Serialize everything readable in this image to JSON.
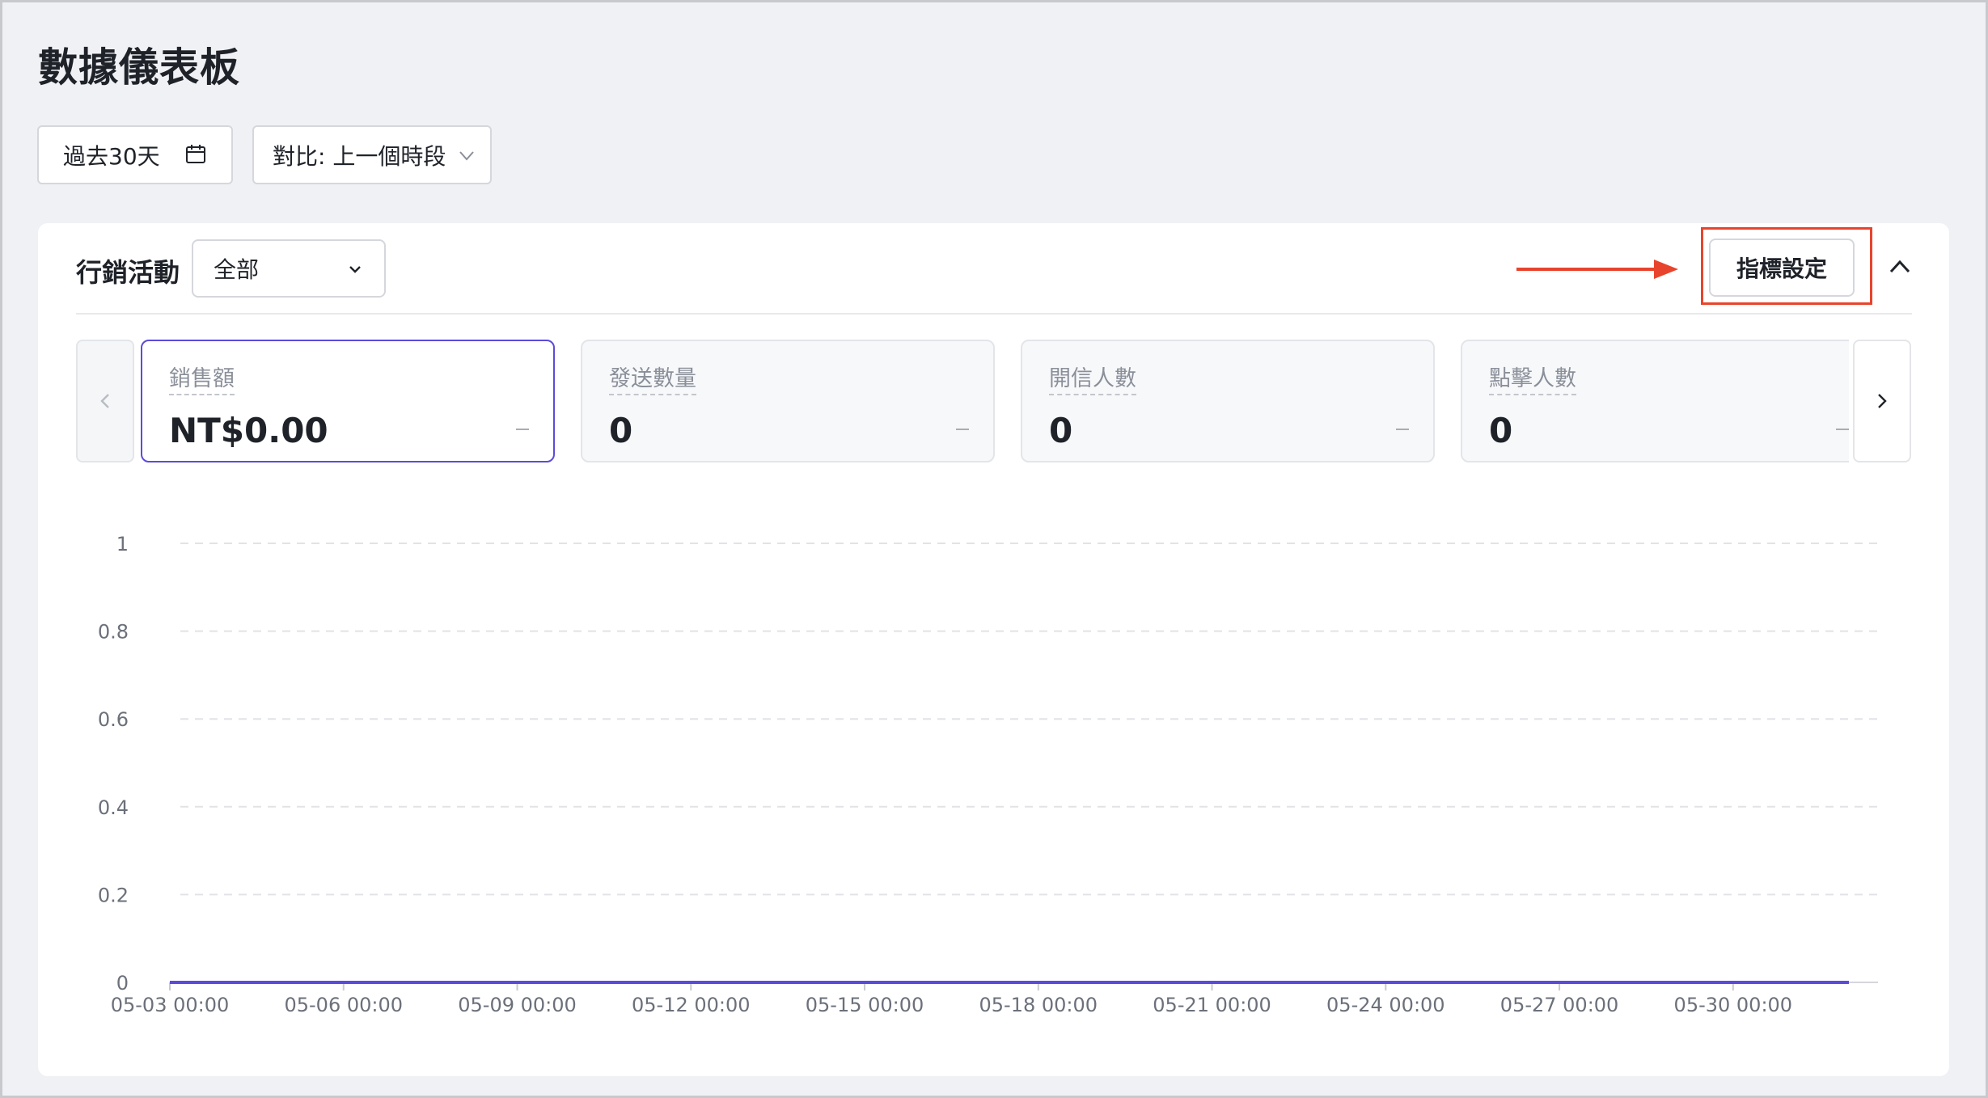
{
  "page": {
    "title": "數據儀表板"
  },
  "filters": {
    "date_range_label": "過去30天",
    "compare_label": "對比: 上一個時段"
  },
  "card": {
    "campaign_label": "行銷活動",
    "campaign_value": "全部",
    "metric_settings_label": "指標設定",
    "annotation_color": "#e8442d"
  },
  "kpis": [
    {
      "name": "銷售額",
      "value": "NT$0.00",
      "active": true
    },
    {
      "name": "發送數量",
      "value": "0",
      "active": false
    },
    {
      "name": "開信人數",
      "value": "0",
      "active": false
    },
    {
      "name": "點擊人數",
      "value": "0",
      "active": false
    }
  ],
  "chart_data": {
    "type": "line",
    "title": "",
    "xlabel": "",
    "ylabel": "",
    "ylim": [
      0,
      1
    ],
    "y_ticks": [
      "0",
      "0.2",
      "0.4",
      "0.6",
      "0.8",
      "1"
    ],
    "x_ticks": [
      "05-03 00:00",
      "05-06 00:00",
      "05-09 00:00",
      "05-12 00:00",
      "05-15 00:00",
      "05-18 00:00",
      "05-21 00:00",
      "05-24 00:00",
      "05-27 00:00",
      "05-30 00:00"
    ],
    "grid": true,
    "series": [
      {
        "color": "#5b4bdb",
        "x_start": "05-03 00:00",
        "x_end": "06-01 00:00",
        "values": [
          0,
          0
        ]
      }
    ]
  }
}
